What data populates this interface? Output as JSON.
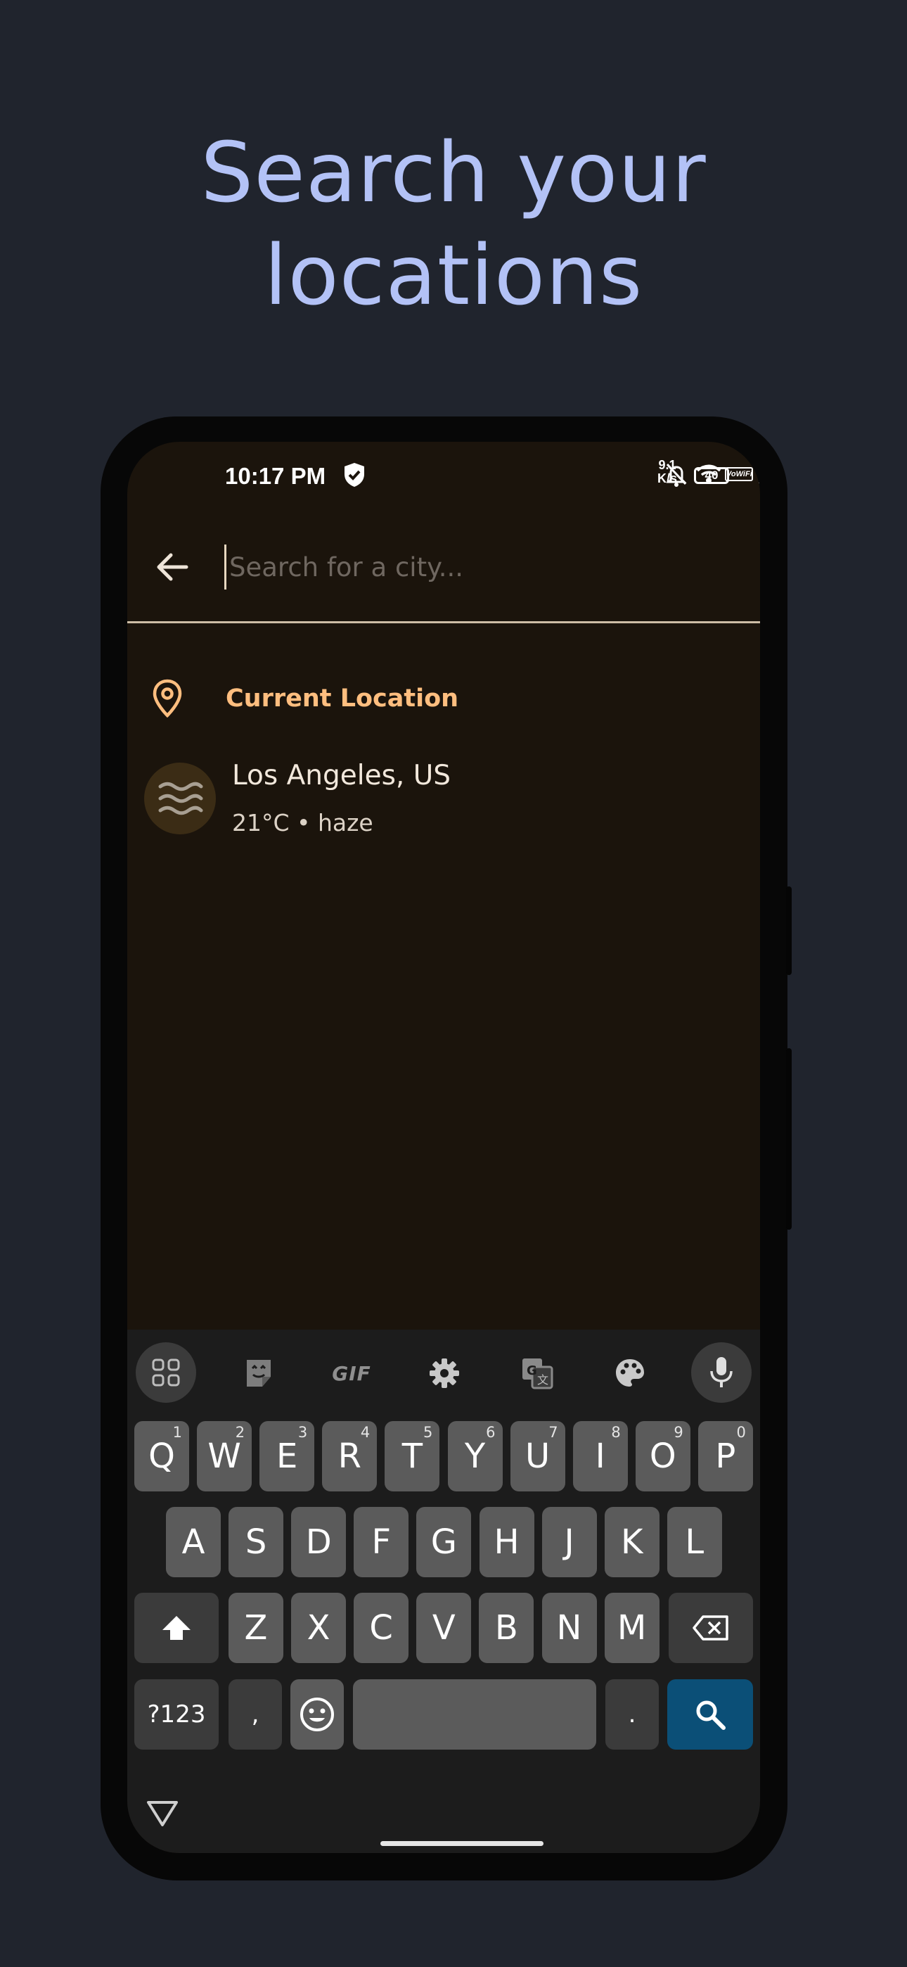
{
  "headline": {
    "line1": "Search your",
    "line2": "locations"
  },
  "status_bar": {
    "time": "10:17 PM",
    "network_speed_value": "9.1",
    "network_speed_unit": "K/s",
    "battery": "40",
    "volte_label": "VoWiFi"
  },
  "app_bar": {
    "search_placeholder": "Search for a city...",
    "search_value": ""
  },
  "current_location": {
    "label": "Current Location",
    "city": "Los Angeles, US",
    "summary": "21°C • haze"
  },
  "keyboard": {
    "toolbar": [
      "apps-grid-icon",
      "sticker-icon",
      "GIF",
      "gear-icon",
      "translate-icon",
      "palette-icon",
      "mic-icon"
    ],
    "gif_label": "GIF",
    "row1": [
      {
        "k": "Q",
        "n": "1"
      },
      {
        "k": "W",
        "n": "2"
      },
      {
        "k": "E",
        "n": "3"
      },
      {
        "k": "R",
        "n": "4"
      },
      {
        "k": "T",
        "n": "5"
      },
      {
        "k": "Y",
        "n": "6"
      },
      {
        "k": "U",
        "n": "7"
      },
      {
        "k": "I",
        "n": "8"
      },
      {
        "k": "O",
        "n": "9"
      },
      {
        "k": "P",
        "n": "0"
      }
    ],
    "row2": [
      "A",
      "S",
      "D",
      "F",
      "G",
      "H",
      "J",
      "K",
      "L"
    ],
    "row3": [
      "Z",
      "X",
      "C",
      "V",
      "B",
      "N",
      "M"
    ],
    "symbols_label": "?123",
    "comma_label": ",",
    "period_label": "."
  },
  "colors": {
    "background": "#20242d",
    "headline": "#b3c2f6",
    "screen": "#1b140c",
    "accent": "#ffbe7f",
    "search_key": "#0b4f77"
  }
}
